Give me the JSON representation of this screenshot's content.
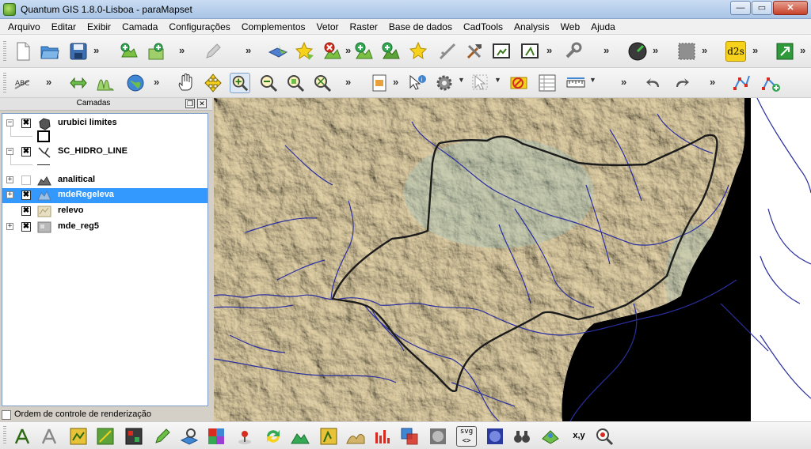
{
  "window": {
    "title": "Quantum GIS 1.8.0-Lisboa - paraMapset",
    "buttons": {
      "minimize": "—",
      "maximize": "▭",
      "close": "✕"
    }
  },
  "menu": {
    "items": [
      "Arquivo",
      "Editar",
      "Exibir",
      "Camada",
      "Configurações",
      "Complementos",
      "Vetor",
      "Raster",
      "Base de dados",
      "CadTools",
      "Analysis",
      "Web",
      "Ajuda"
    ]
  },
  "toolbar1": {
    "overflow": "»",
    "d2s_label": "d2s",
    "icons": [
      "new-project-icon",
      "open-project-icon",
      "save-project-icon",
      "add-vector-icon",
      "add-raster-icon",
      "edit-pencil-icon",
      "layer-add-icon",
      "layer-star-icon",
      "layer-remove-icon",
      "layer-add-green-icon",
      "layer-add-green2-icon",
      "layer-star2-icon",
      "digitize-icon",
      "wrench-hammer-icon",
      "frame-icon",
      "frame2-icon",
      "settings-wrench-icon",
      "globe-dark-icon",
      "grey-square-icon",
      "d2s-icon",
      "green-export-icon"
    ]
  },
  "toolbar2": {
    "overflow": "»",
    "icons": [
      "label-abc-icon",
      "georef-icon",
      "histogram-icon",
      "globe-icon",
      "pan-hand-icon",
      "pan-to-selection-icon",
      "zoom-in-icon",
      "zoom-out-icon",
      "zoom-layer-icon",
      "zoom-full-icon",
      "print-composer-icon",
      "identify-icon",
      "gear-icon",
      "select-icon",
      "deselect-icon",
      "attribute-table-icon",
      "measure-icon",
      "undo-icon",
      "redo-icon",
      "node-tool-icon",
      "add-node-icon"
    ]
  },
  "layers_panel": {
    "title": "Camadas",
    "float_btn": "❐",
    "close_btn": "✕",
    "layers": [
      {
        "name": "urubici limites",
        "checked": true,
        "expanded": true,
        "selected": false,
        "icon": "polygon-layer-icon"
      },
      {
        "name": "SC_HIDRO_LINE",
        "checked": true,
        "expanded": true,
        "selected": false,
        "icon": "line-layer-icon"
      },
      {
        "name": "analitical",
        "checked": false,
        "expanded": false,
        "selected": false,
        "icon": "raster-layer-icon"
      },
      {
        "name": "mdeRegeleva",
        "checked": true,
        "expanded": false,
        "selected": true,
        "icon": "raster-blue-layer-icon"
      },
      {
        "name": "relevo",
        "checked": true,
        "expanded": false,
        "selected": false,
        "icon": "raster-relief-layer-icon"
      },
      {
        "name": "mde_reg5",
        "checked": true,
        "expanded": false,
        "selected": false,
        "icon": "raster-grey-layer-icon"
      }
    ],
    "render_order_label": "Ordem de controle de renderização",
    "checkmark": "✖",
    "expand_symbol": "+",
    "collapse_symbol": "−"
  },
  "toolbar3": {
    "svg_label": "svg",
    "xy_label": "x,y",
    "icons": [
      "grass-tools-icon",
      "grass-tools2-icon",
      "map-layer-icon",
      "vector-edit-icon",
      "raster-calc-icon",
      "pencil-green-icon",
      "spatial-query-icon",
      "color-grid-icon",
      "location-pin-icon",
      "refresh-icon",
      "terrain-icon",
      "cad-tool-icon",
      "profile-icon",
      "histogram2-icon",
      "overlay-icon",
      "hillshade-icon",
      "svg-icon",
      "blur-icon",
      "binoculars-icon",
      "georef2-icon",
      "coordinate-capture-icon",
      "zoom-search-icon"
    ]
  },
  "colors": {
    "selection": "#3399ff",
    "boundary": "#1b1b1b",
    "rivers": "#2a2f9e",
    "terrain": "#cdbb8f"
  }
}
